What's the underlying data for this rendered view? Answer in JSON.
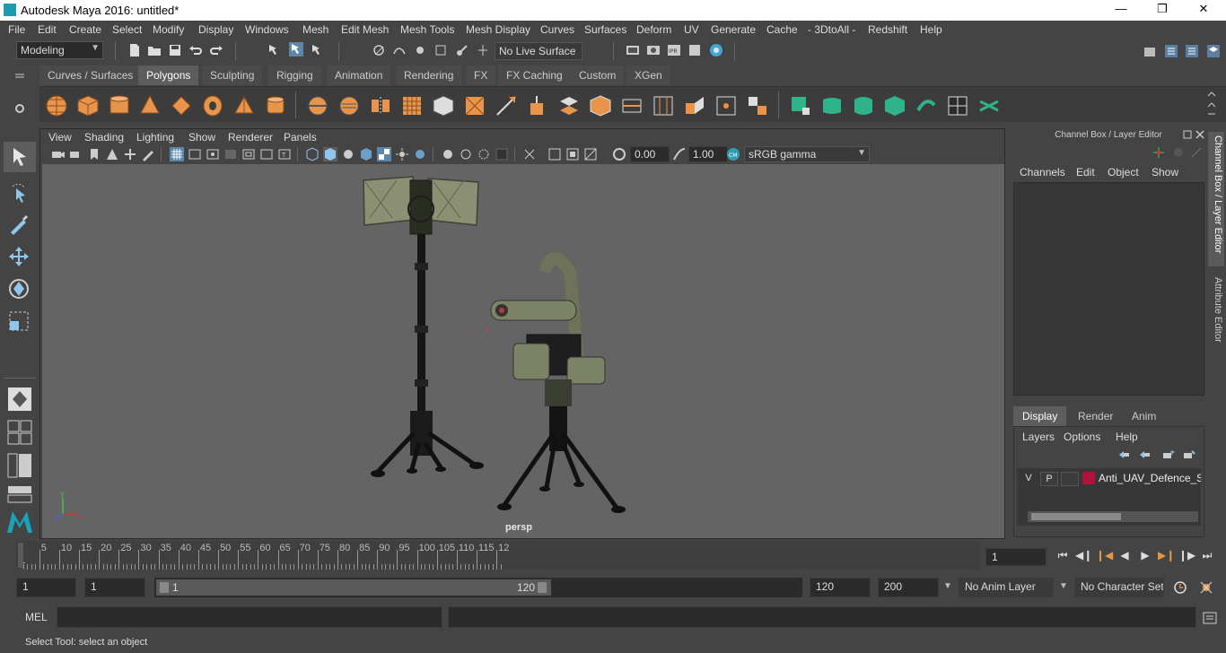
{
  "window": {
    "title": "Autodesk Maya 2016: untitled*"
  },
  "menubar": [
    "File",
    "Edit",
    "Create",
    "Select",
    "Modify",
    "Display",
    "Windows",
    "Mesh",
    "Edit Mesh",
    "Mesh Tools",
    "Mesh Display",
    "Curves",
    "Surfaces",
    "Deform",
    "UV",
    "Generate",
    "Cache",
    "- 3DtoAll -",
    "Redshift",
    "Help"
  ],
  "statusline": {
    "mode": "Modeling",
    "live_surface": "No Live Surface"
  },
  "shelf": {
    "tabs": [
      "Curves / Surfaces",
      "Polygons",
      "Sculpting",
      "Rigging",
      "Animation",
      "Rendering",
      "FX",
      "FX Caching",
      "Custom",
      "XGen"
    ],
    "active_tab": "Polygons"
  },
  "viewport": {
    "menu": [
      "View",
      "Shading",
      "Lighting",
      "Show",
      "Renderer",
      "Panels"
    ],
    "near_value": "0.00",
    "far_value": "1.00",
    "colorspace": "sRGB gamma",
    "camera_label": "persp"
  },
  "right_panel": {
    "title": "Channel Box / Layer Editor",
    "channel_menu": [
      "Channels",
      "Edit",
      "Object",
      "Show"
    ],
    "layer_tabs": [
      "Display",
      "Render",
      "Anim"
    ],
    "active_layer_tab": "Display",
    "layer_menu": [
      "Layers",
      "Options",
      "Help"
    ],
    "layer": {
      "v": "V",
      "p": "P",
      "name": "Anti_UAV_Defence_Sys",
      "color": "#b0123a"
    },
    "side_tabs": [
      "Channel Box / Layer Editor",
      "Attribute Editor"
    ]
  },
  "timeline": {
    "ticks": [
      "5",
      "10",
      "15",
      "20",
      "25",
      "30",
      "35",
      "40",
      "45",
      "50",
      "55",
      "60",
      "65",
      "70",
      "75",
      "80",
      "85",
      "90",
      "95",
      "100",
      "105",
      "110",
      "115",
      "12"
    ],
    "start_marker": "1",
    "current_frame": "1"
  },
  "range": {
    "start": "1",
    "playback_start": "1",
    "slider_start": "1",
    "slider_end": "120",
    "playback_end": "120",
    "end": "200",
    "anim_layer": "No Anim Layer",
    "character_set": "No Character Set"
  },
  "mel": {
    "label": "MEL"
  },
  "helpline": {
    "text": "Select Tool: select an object"
  }
}
